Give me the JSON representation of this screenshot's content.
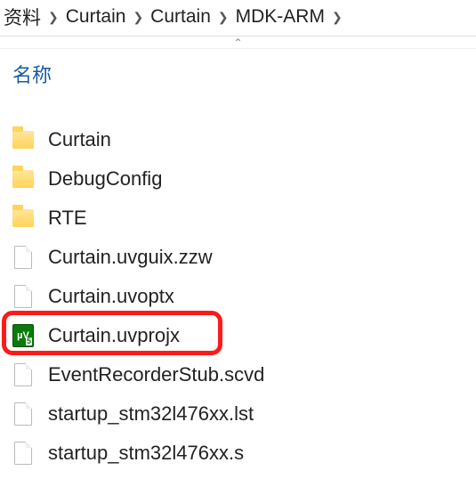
{
  "breadcrumb": {
    "items": [
      "资料",
      "Curtain",
      "Curtain",
      "MDK-ARM"
    ]
  },
  "columnHeader": "名称",
  "files": [
    {
      "name": "Curtain",
      "iconType": "folder"
    },
    {
      "name": "DebugConfig",
      "iconType": "folder"
    },
    {
      "name": "RTE",
      "iconType": "folder"
    },
    {
      "name": "Curtain.uvguix.zzw",
      "iconType": "file"
    },
    {
      "name": "Curtain.uvoptx",
      "iconType": "file"
    },
    {
      "name": "Curtain.uvprojx",
      "iconType": "uvprojx",
      "highlighted": true
    },
    {
      "name": "EventRecorderStub.scvd",
      "iconType": "file"
    },
    {
      "name": "startup_stm32l476xx.lst",
      "iconType": "file"
    },
    {
      "name": "startup_stm32l476xx.s",
      "iconType": "file"
    }
  ]
}
